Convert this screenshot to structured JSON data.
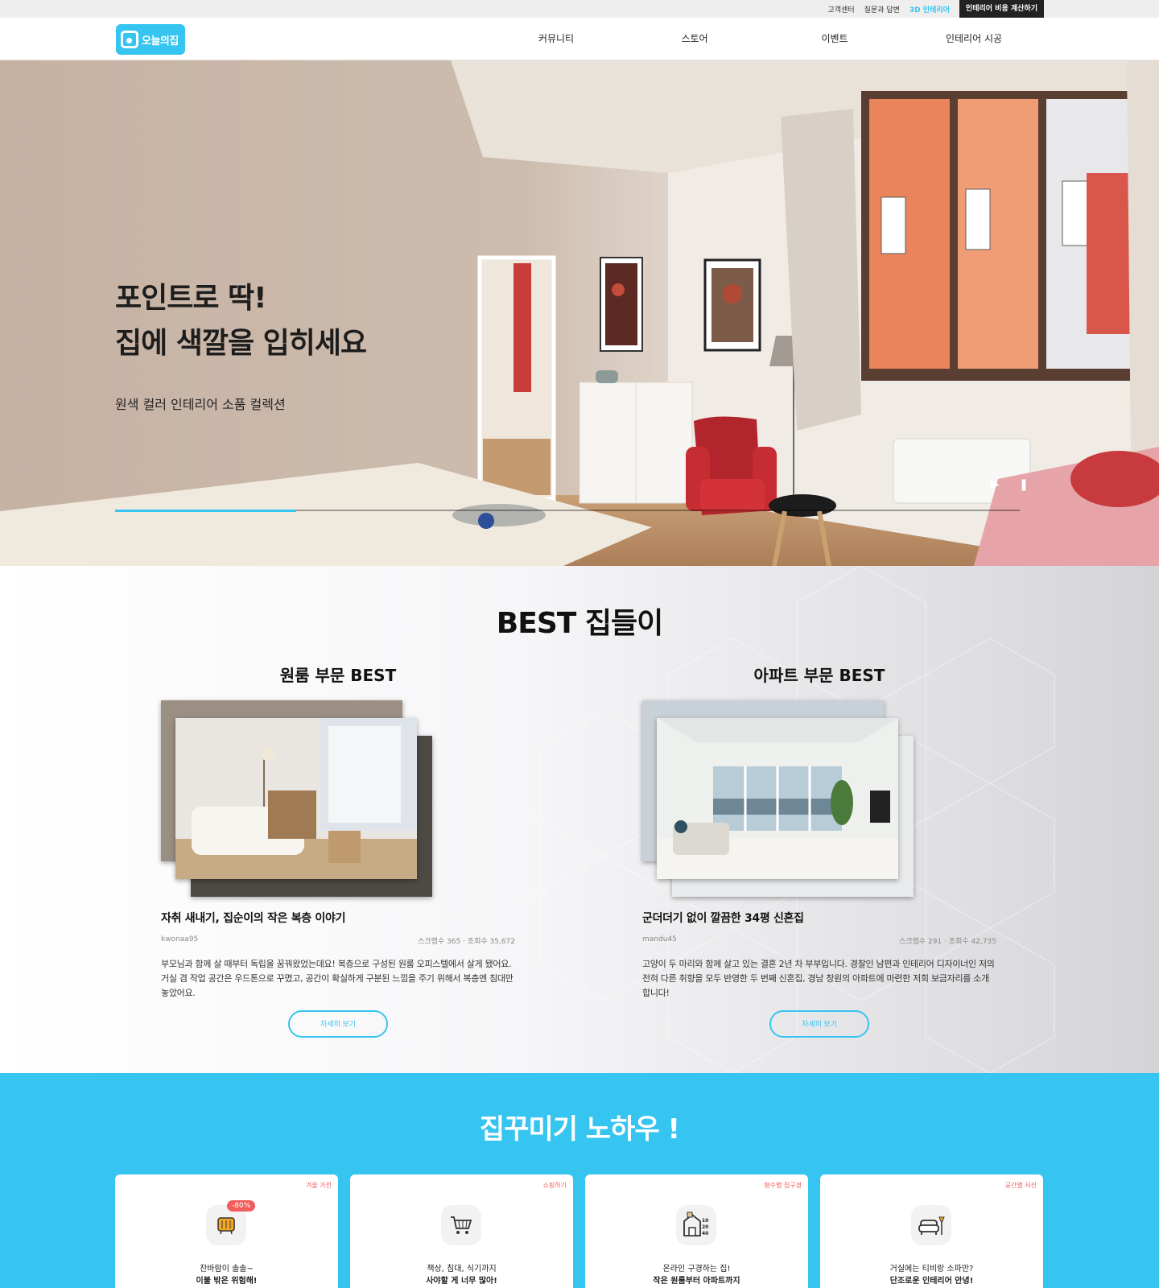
{
  "util_bar": {
    "links": [
      "고객센터",
      "질문과 답변",
      "3D 인테리어",
      "인테리어 비용 계산하기"
    ]
  },
  "header": {
    "logo_text": "오늘의집",
    "nav": [
      "커뮤니티",
      "스토어",
      "이벤트",
      "인테리어 시공"
    ]
  },
  "hero": {
    "title_line1": "포인트로 딱!",
    "title_line2": "집에 색깔을 입히세요",
    "subtitle": "원색 컬러 인테리어 소품 컬렉션",
    "progress": 0.2
  },
  "best": {
    "title": "BEST 집들이",
    "columns": [
      {
        "heading": "원룸 부문 BEST",
        "title": "자취 새내기, 집순이의 작은 복층 이야기",
        "author": "kwonaa95",
        "stats": "스크랩수 365 · 조회수 35,672",
        "desc": "부모님과 함께 살 때부터 독립을 꿈꿔왔었는데요! 복층으로 구성된 원룸 오피스텔에서 살게 됐어요. 거실 겸 작업 공간은 우드톤으로 꾸몄고, 공간이 확실하게 구분된 느낌을 주기 위해서 복층엔 침대만 놓았어요.",
        "button": "자세히 보기"
      },
      {
        "heading": "아파트 부문 BEST",
        "title": "군더더기 없이 깔끔한 34평 신혼집",
        "author": "mandu45",
        "stats": "스크랩수 291 · 조회수 42,735",
        "desc": "고양이 두 마리와 함께 살고 있는 결혼 2년 차 부부입니다. 경찰인 남편과 인테리어 디자이너인 저의 전혀 다른 취향을 모두 반영한 두 번째 신혼집, 경남 창원의 아파트에 마련한 저희 보금자리를 소개합니다!",
        "button": "자세히 보기"
      }
    ]
  },
  "knowhow": {
    "title": "집꾸미기 노하우 !",
    "cards": [
      {
        "tag": "겨울 가전",
        "line1": "찬바람이 솔솔~",
        "line2": "이불 밖은 위험해!",
        "badge": "-80%",
        "icon": "heater-icon"
      },
      {
        "tag": "쇼핑하기",
        "line1": "책상, 침대, 식기까지",
        "line2": "사야할 게 너무 많아!",
        "icon": "cart-icon"
      },
      {
        "tag": "평수별 집구경",
        "line1": "온라인 구경하는 집!",
        "line2": "작은 원룸부터 아파트까지",
        "icon": "house-size-icon",
        "icon_numbers": [
          "10",
          "20",
          "40"
        ]
      },
      {
        "tag": "공간별 사진",
        "line1": "거실에는 티비랑 소파만?",
        "line2": "단조로운 인테리어 안녕!",
        "icon": "sofa-icon"
      }
    ]
  },
  "colors": {
    "accent": "#35c5f0",
    "tag_red": "#f25c5c",
    "dark": "#222222"
  }
}
